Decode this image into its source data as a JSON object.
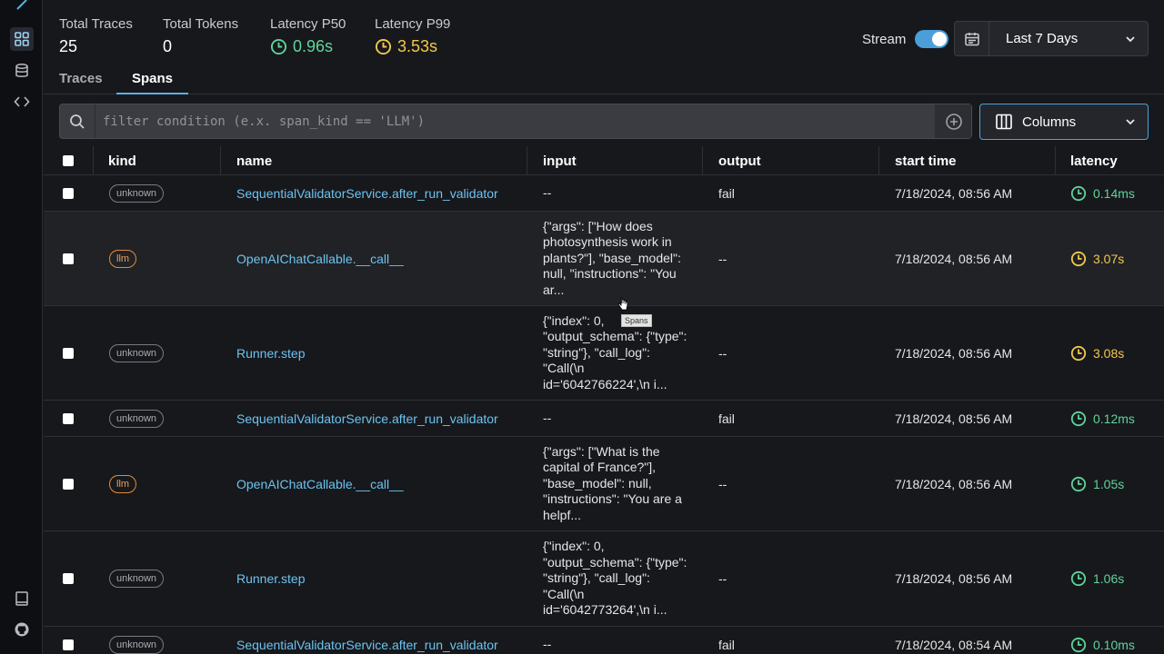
{
  "stats": {
    "total_traces_label": "Total Traces",
    "total_traces_value": "25",
    "total_tokens_label": "Total Tokens",
    "total_tokens_value": "0",
    "latency_p50_label": "Latency P50",
    "latency_p50_value": "0.96s",
    "latency_p99_label": "Latency P99",
    "latency_p99_value": "3.53s"
  },
  "header": {
    "stream_label": "Stream",
    "stream_on": true,
    "date_range": "Last 7 Days"
  },
  "tabs": [
    {
      "label": "Traces",
      "active": false
    },
    {
      "label": "Spans",
      "active": true
    }
  ],
  "filter": {
    "placeholder": "filter condition (e.x. span_kind == 'LLM')"
  },
  "columns_button": "Columns",
  "table": {
    "headers": {
      "kind": "kind",
      "name": "name",
      "input": "input",
      "output": "output",
      "start_time": "start time",
      "latency": "latency"
    },
    "rows": [
      {
        "kind": "unknown",
        "name": "SequentialValidatorService.after_run_validator",
        "input": "--",
        "output": "fail",
        "start_time": "7/18/2024, 08:56 AM",
        "latency": "0.14ms",
        "latency_status": "green"
      },
      {
        "kind": "llm",
        "name": "OpenAIChatCallable.__call__",
        "input": "{\"args\": [\"How does photosynthesis work in plants?\"], \"base_model\": null, \"instructions\": \"You ar...",
        "output": "--",
        "start_time": "7/18/2024, 08:56 AM",
        "latency": "3.07s",
        "latency_status": "yellow"
      },
      {
        "kind": "unknown",
        "name": "Runner.step",
        "input": "{\"index\": 0, \"output_schema\": {\"type\": \"string\"}, \"call_log\": \"Call(\\n id='6042766224',\\n i...",
        "output": "--",
        "start_time": "7/18/2024, 08:56 AM",
        "latency": "3.08s",
        "latency_status": "yellow"
      },
      {
        "kind": "unknown",
        "name": "SequentialValidatorService.after_run_validator",
        "input": "--",
        "output": "fail",
        "start_time": "7/18/2024, 08:56 AM",
        "latency": "0.12ms",
        "latency_status": "green"
      },
      {
        "kind": "llm",
        "name": "OpenAIChatCallable.__call__",
        "input": "{\"args\": [\"What is the capital of France?\"], \"base_model\": null, \"instructions\": \"You are a helpf...",
        "output": "--",
        "start_time": "7/18/2024, 08:56 AM",
        "latency": "1.05s",
        "latency_status": "green"
      },
      {
        "kind": "unknown",
        "name": "Runner.step",
        "input": "{\"index\": 0, \"output_schema\": {\"type\": \"string\"}, \"call_log\": \"Call(\\n id='6042773264',\\n i...",
        "output": "--",
        "start_time": "7/18/2024, 08:56 AM",
        "latency": "1.06s",
        "latency_status": "green"
      },
      {
        "kind": "unknown",
        "name": "SequentialValidatorService.after_run_validator",
        "input": "--",
        "output": "fail",
        "start_time": "7/18/2024, 08:54 AM",
        "latency": "0.10ms",
        "latency_status": "green"
      }
    ]
  },
  "tooltip": "Spans",
  "colors": {
    "accent": "#5ab0e6",
    "link": "#6cc3f0",
    "green": "#5fd49a",
    "yellow": "#f2c94c",
    "llm": "#e08a3a"
  },
  "icons": [
    "dashboard-icon",
    "database-icon",
    "code-icon",
    "book-icon",
    "github-icon",
    "clock-icon",
    "calendar-icon",
    "chevron-down-icon",
    "search-icon",
    "plus-circle-icon",
    "columns-icon"
  ]
}
